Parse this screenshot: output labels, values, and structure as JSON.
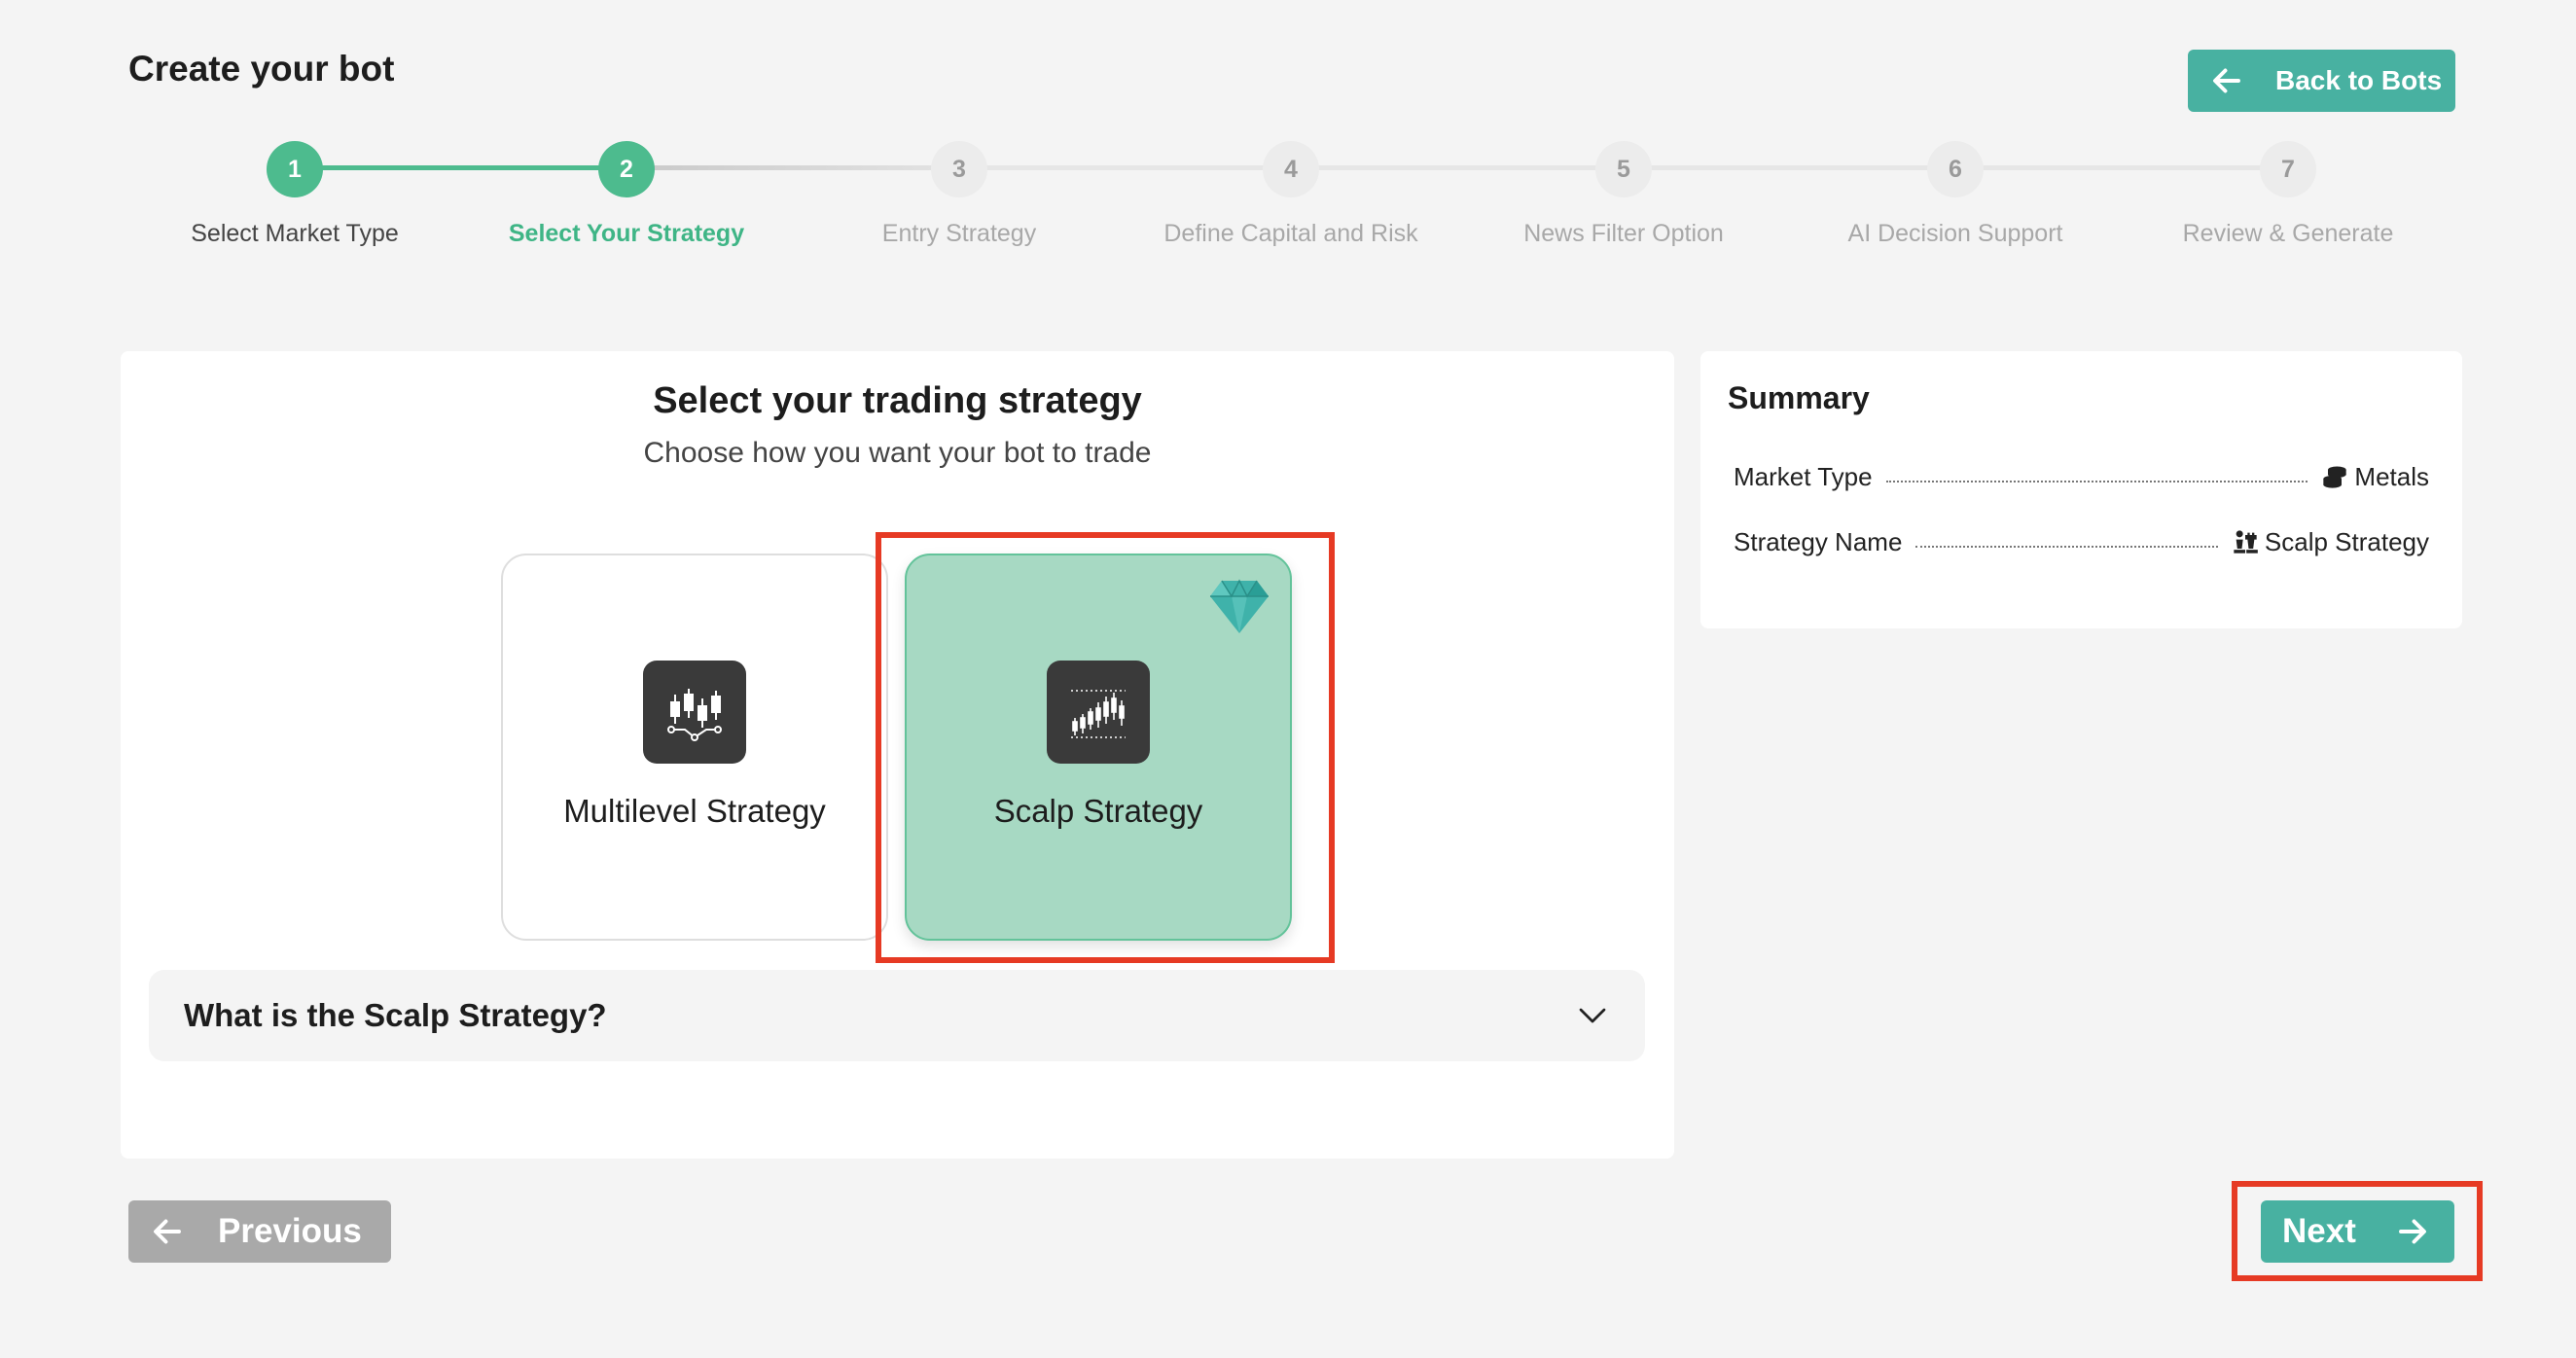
{
  "page": {
    "title": "Create your bot"
  },
  "header": {
    "back_label": "Back to Bots"
  },
  "stepper": {
    "steps": [
      {
        "number": "1",
        "label": "Select Market Type",
        "state": "done"
      },
      {
        "number": "2",
        "label": "Select Your Strategy",
        "state": "active"
      },
      {
        "number": "3",
        "label": "Entry Strategy",
        "state": "todo"
      },
      {
        "number": "4",
        "label": "Define Capital and Risk",
        "state": "todo"
      },
      {
        "number": "5",
        "label": "News Filter Option",
        "state": "todo"
      },
      {
        "number": "6",
        "label": "AI Decision Support",
        "state": "todo"
      },
      {
        "number": "7",
        "label": "Review & Generate",
        "state": "todo"
      }
    ]
  },
  "main": {
    "heading": "Select your trading strategy",
    "subheading": "Choose how you want your bot to trade",
    "options": [
      {
        "label": "Multilevel Strategy",
        "icon": "candlestick-chart-icon",
        "selected": false
      },
      {
        "label": "Scalp Strategy",
        "icon": "candlestick-scalp-icon",
        "selected": true,
        "badge": "diamond-icon"
      }
    ],
    "accordion": {
      "title": "What is the Scalp Strategy?",
      "expanded": false
    }
  },
  "summary": {
    "title": "Summary",
    "rows": [
      {
        "key": "Market Type",
        "value": "Metals",
        "icon": "coins-icon"
      },
      {
        "key": "Strategy Name",
        "value": "Scalp Strategy",
        "icon": "chess-icon"
      }
    ]
  },
  "footer": {
    "previous_label": "Previous",
    "next_label": "Next"
  },
  "colors": {
    "accent": "#48b1a1",
    "step_done": "#4dbb8e",
    "selected_card": "#a7d9c3",
    "highlight": "#e63a24",
    "disabled_button": "#a9a9a9"
  }
}
